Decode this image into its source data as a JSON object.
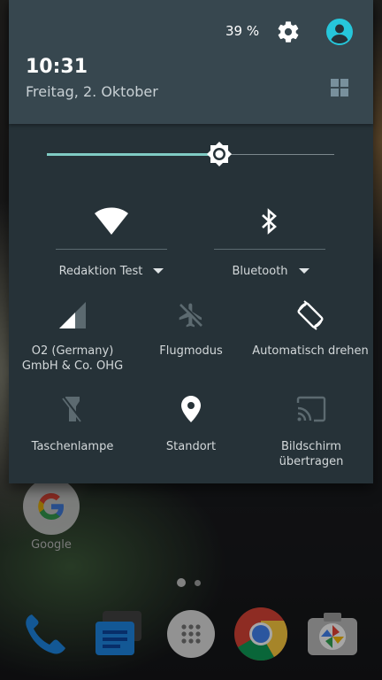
{
  "status": {
    "battery": "39 %",
    "settings_icon": "gear-icon",
    "user_icon": "account-circle-icon"
  },
  "header": {
    "time": "10:31",
    "date": "Freitag, 2. Oktober",
    "edit_icon": "grid-icon"
  },
  "brightness": {
    "level": 0.6,
    "icon": "brightness-icon"
  },
  "tiles": {
    "wifi": {
      "label": "Redaktion Test",
      "icon": "wifi-icon"
    },
    "bluetooth": {
      "label": "Bluetooth",
      "icon": "bluetooth-icon"
    },
    "cellular": {
      "label": "O2 (Germany) GmbH & Co. OHG",
      "icon": "signal-icon"
    },
    "airplane": {
      "label": "Flugmodus",
      "icon": "airplane-icon"
    },
    "rotate": {
      "label": "Automatisch drehen",
      "icon": "rotate-icon"
    },
    "flashlight": {
      "label": "Taschenlampe",
      "icon": "flashlight-icon"
    },
    "location": {
      "label": "Standort",
      "icon": "location-pin-icon"
    },
    "cast": {
      "label": "Bildschirm übertragen",
      "icon": "cast-icon"
    }
  },
  "home": {
    "google_app_label": "Google",
    "page_indicator": {
      "current": 1,
      "total": 2
    },
    "dock": [
      "phone-icon",
      "messages-icon",
      "app-drawer-icon",
      "chrome-icon",
      "camera-icon"
    ]
  },
  "colors": {
    "panel_bg": "#263238",
    "header_bg": "#37474f",
    "accent": "#80cbc4",
    "avatar": "#26c6da"
  }
}
